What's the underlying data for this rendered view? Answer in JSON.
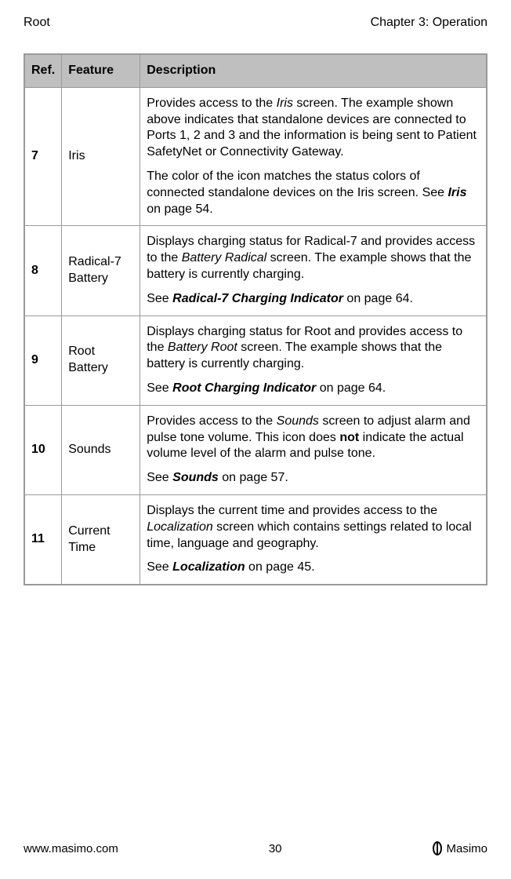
{
  "header": {
    "left": "Root",
    "right": "Chapter 3: Operation"
  },
  "table": {
    "headers": {
      "ref": "Ref.",
      "feature": "Feature",
      "description": "Description"
    },
    "rows": [
      {
        "ref": "7",
        "feature": "Iris",
        "desc_p1_pre": "Provides access to the ",
        "desc_p1_italic1": "Iris",
        "desc_p1_post": " screen. The example shown above indicates that standalone devices are connected to Ports 1, 2 and 3 and the information is being sent to Patient SafetyNet or Connectivity Gateway.",
        "desc_p2_pre": "The color of the icon matches the status colors of connected standalone devices on the Iris screen. See ",
        "desc_p2_bolditalic": "Iris",
        "desc_p2_post": " on page 54."
      },
      {
        "ref": "8",
        "feature": "Radical-7 Battery",
        "desc_p1_pre": "Displays charging status for Radical-7 and provides access to the ",
        "desc_p1_italic1": "Battery Radical",
        "desc_p1_post": " screen. The example shows that the battery is currently charging.",
        "desc_p2_pre": "See ",
        "desc_p2_bolditalic": "Radical-7 Charging Indicator",
        "desc_p2_post": " on page 64."
      },
      {
        "ref": "9",
        "feature": "Root Battery",
        "desc_p1_pre": "Displays charging status for Root and provides access to the ",
        "desc_p1_italic1": "Battery Root",
        "desc_p1_post": " screen. The example shows that the battery is currently charging.",
        "desc_p2_pre": "See ",
        "desc_p2_bolditalic": "Root Charging Indicator",
        "desc_p2_post": " on page 64."
      },
      {
        "ref": "10",
        "feature": "Sounds",
        "desc_p1_pre": "Provides access to the ",
        "desc_p1_italic1": "Sounds",
        "desc_p1_mid": " screen to adjust alarm and pulse tone volume. This icon does ",
        "desc_p1_bold": "not",
        "desc_p1_post": " indicate the actual volume level of the alarm and pulse tone.",
        "desc_p2_pre": "See ",
        "desc_p2_bolditalic": "Sounds",
        "desc_p2_post": " on page 57."
      },
      {
        "ref": "11",
        "feature": "Current Time",
        "desc_p1_pre": "Displays the current time and provides access to the ",
        "desc_p1_italic1": "Localization",
        "desc_p1_post": " screen which contains settings related to local time, language and geography.",
        "desc_p2_pre": "See ",
        "desc_p2_bolditalic": "Localization",
        "desc_p2_post": " on page 45."
      }
    ]
  },
  "footer": {
    "left": "www.masimo.com",
    "center": "30",
    "right": "Masimo"
  }
}
